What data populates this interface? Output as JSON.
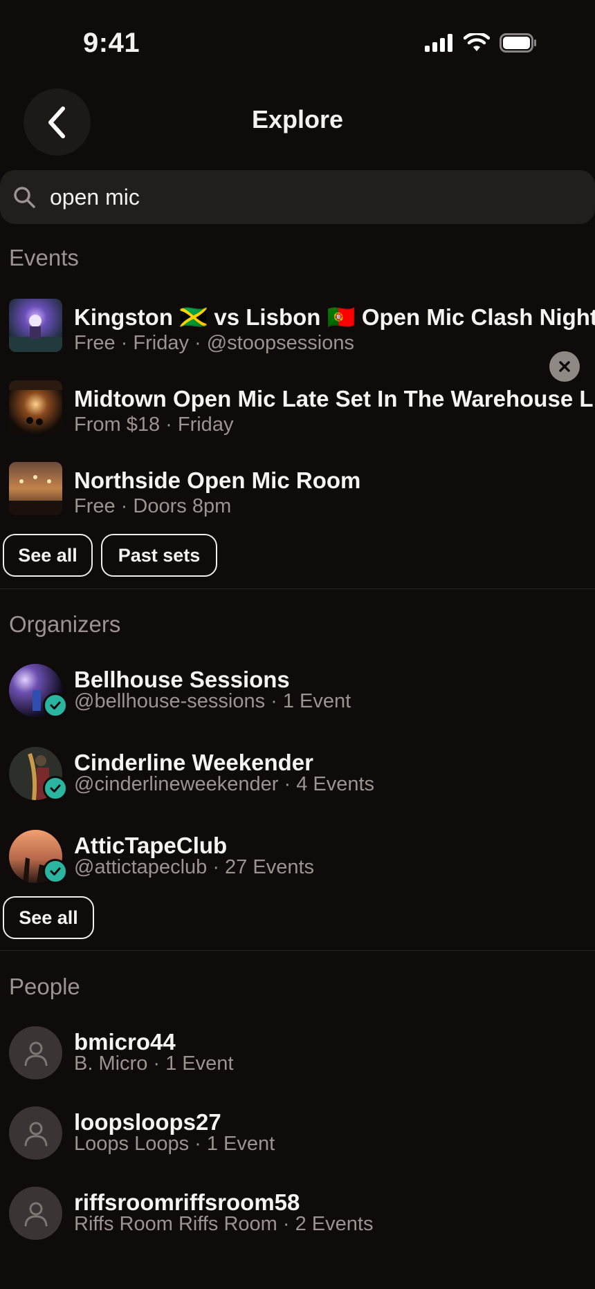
{
  "status_bar": {
    "time": "9:41"
  },
  "header": {
    "title": "Explore"
  },
  "search": {
    "value": "open mic"
  },
  "events": {
    "title": "Events",
    "items": [
      {
        "title": "Kingston 🇯🇲 vs Lisbon 🇵🇹 Open Mic Clash Night",
        "subtitle": "Free · Friday · @stoopsessions"
      },
      {
        "title": "Midtown Open Mic Late Set In The Warehouse L",
        "subtitle": "From $18 · Friday"
      },
      {
        "title": "Northside Open Mic Room",
        "subtitle": "Free · Doors 8pm"
      }
    ],
    "see_all": "See all",
    "past_sets": "Past sets"
  },
  "organizers": {
    "title": "Organizers",
    "items": [
      {
        "name": "Bellhouse Sessions",
        "subtitle": "@bellhouse-sessions · 1 Event"
      },
      {
        "name": "Cinderline Weekender",
        "subtitle": "@cinderlineweekender · 4 Events"
      },
      {
        "name": "AtticTapeClub",
        "subtitle": "@attictapeclub · 27 Events"
      }
    ],
    "see_all": "See all"
  },
  "people": {
    "title": "People",
    "items": [
      {
        "name": "bmicro44",
        "subtitle": "B. Micro · 1 Event"
      },
      {
        "name": "loopsloops27",
        "subtitle": "Loops Loops · 1 Event"
      },
      {
        "name": "riffsroomriffsroom58",
        "subtitle": "Riffs Room Riffs Room · 2 Events"
      }
    ]
  },
  "colors": {
    "background": "#0e0b0a",
    "muted_text": "#9b9491",
    "verified": "#2bb5a0"
  }
}
